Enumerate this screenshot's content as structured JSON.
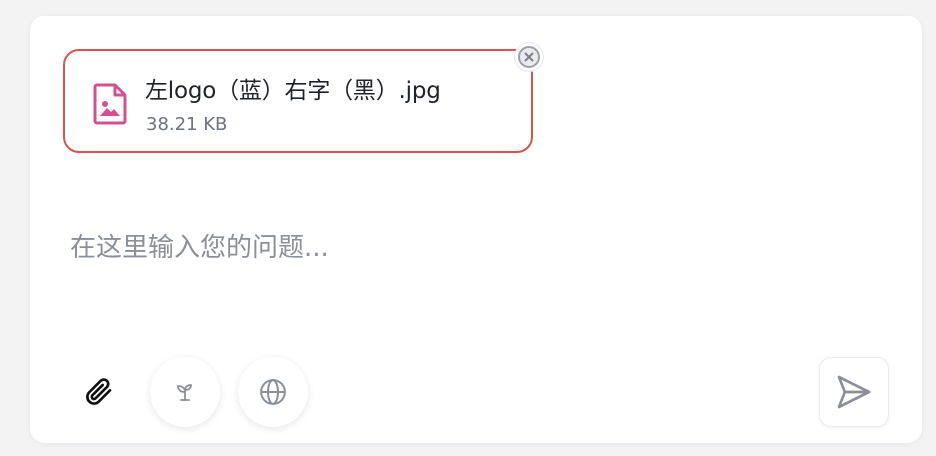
{
  "attachment": {
    "file_name": "左logo（蓝）右字（黑）.jpg",
    "file_size": "38.21 KB",
    "icon": "image-file-icon",
    "accent_color": "#d9534f"
  },
  "remove_icon": "close-circle-icon",
  "prompt": {
    "placeholder": "在这里输入您的问题..."
  },
  "toolbar": {
    "attach_icon": "paperclip-icon",
    "seed_icon": "sprout-icon",
    "web_icon": "globe-icon",
    "send_icon": "send-icon"
  }
}
